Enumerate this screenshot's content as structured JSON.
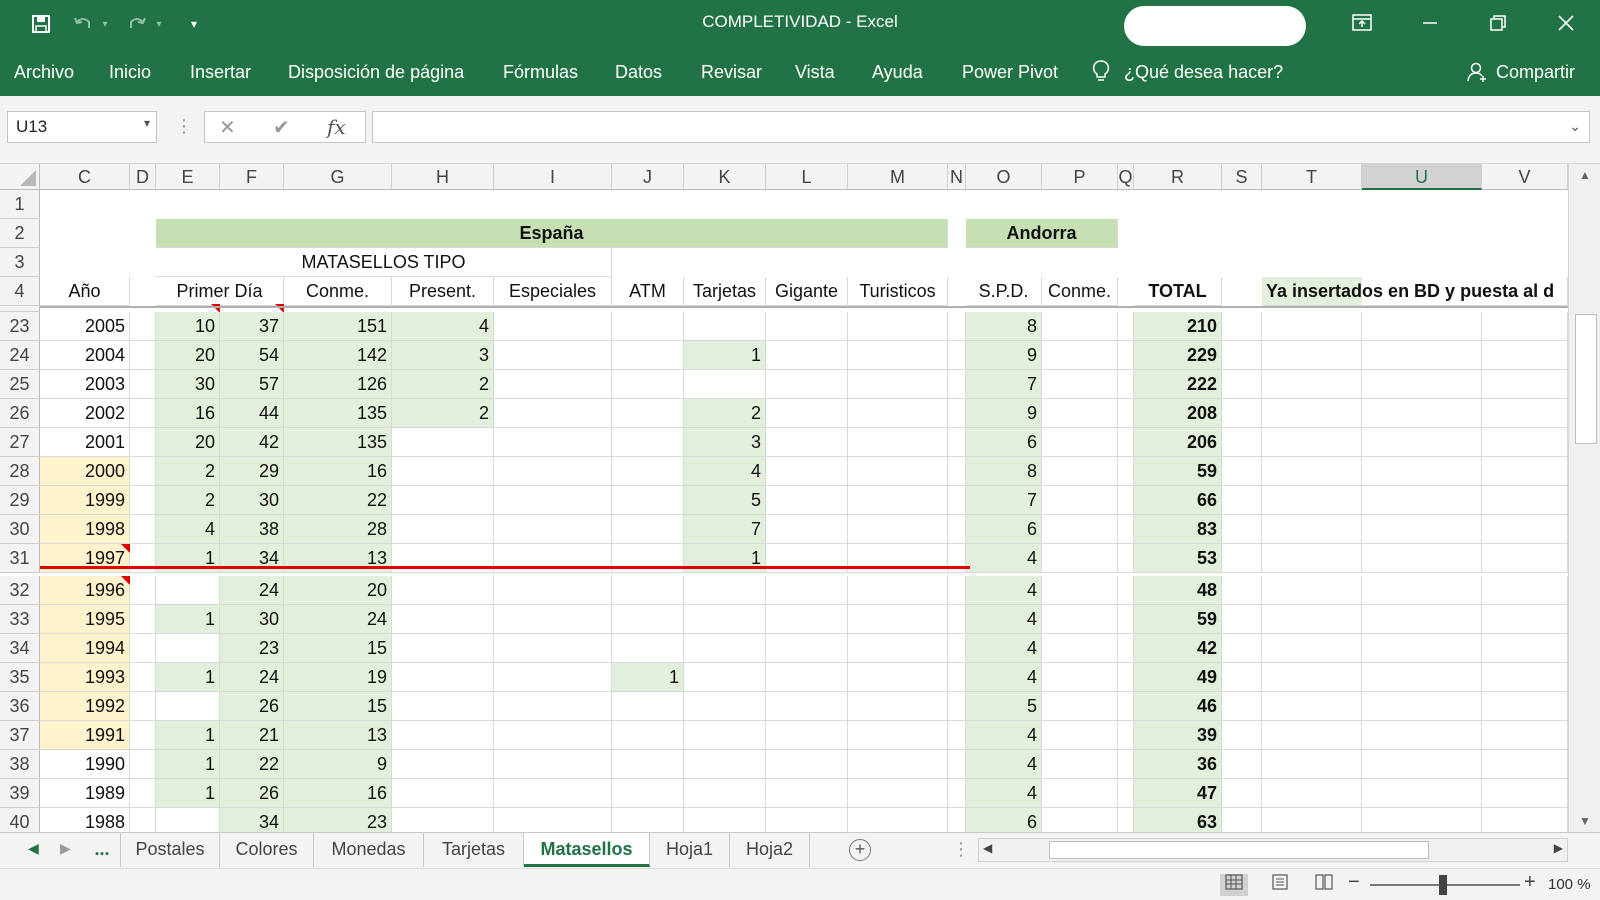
{
  "window": {
    "title": "COMPLETIVIDAD  -  Excel",
    "quick_access": [
      "save-icon",
      "undo-icon",
      "redo-icon",
      "customize-qat-icon"
    ]
  },
  "ribbon": {
    "tabs": [
      "Archivo",
      "Inicio",
      "Insertar",
      "Disposición de página",
      "Fórmulas",
      "Datos",
      "Revisar",
      "Vista",
      "Ayuda",
      "Power Pivot"
    ],
    "tell_me": "¿Qué desea hacer?",
    "share": "Compartir"
  },
  "formula_bar": {
    "name_box": "U13",
    "fx": "fx",
    "formula": ""
  },
  "columns": [
    "C",
    "D",
    "E",
    "F",
    "G",
    "H",
    "I",
    "J",
    "K",
    "L",
    "M",
    "N",
    "O",
    "P",
    "Q",
    "R",
    "S",
    "T",
    "U",
    "V"
  ],
  "selected_column": "U",
  "header_rows": {
    "r1": "1",
    "r2": "2",
    "r3": "3",
    "r4": "4",
    "espana": "España",
    "andorra": "Andorra",
    "matasellos_tipo": "MATASELLOS TIPO",
    "anio": "Año",
    "primer_dia": "Primer Día",
    "conme": "Conme.",
    "present": "Present.",
    "especiales": "Especiales",
    "atm": "ATM",
    "tarjetas": "Tarjetas",
    "gigante": "Gigante",
    "turisticos": "Turisticos",
    "spd": "S.P.D.",
    "conme2": "Conme.",
    "total": "TOTAL",
    "ya_insertados": "Ya insertados en BD y puesta al d"
  },
  "rows": [
    {
      "row": "23",
      "C": "2005",
      "E": "10",
      "F": "37",
      "G": "151",
      "H": "4",
      "J": "",
      "K": "",
      "O": "8",
      "R": "210"
    },
    {
      "row": "24",
      "C": "2004",
      "E": "20",
      "F": "54",
      "G": "142",
      "H": "3",
      "J": "",
      "K": "1",
      "O": "9",
      "R": "229"
    },
    {
      "row": "25",
      "C": "2003",
      "E": "30",
      "F": "57",
      "G": "126",
      "H": "2",
      "J": "",
      "K": "",
      "O": "7",
      "R": "222"
    },
    {
      "row": "26",
      "C": "2002",
      "E": "16",
      "F": "44",
      "G": "135",
      "H": "2",
      "J": "",
      "K": "2",
      "O": "9",
      "R": "208"
    },
    {
      "row": "27",
      "C": "2001",
      "E": "20",
      "F": "42",
      "G": "135",
      "H": "",
      "J": "",
      "K": "3",
      "O": "6",
      "R": "206"
    },
    {
      "row": "28",
      "C": "2000",
      "E": "2",
      "F": "29",
      "G": "16",
      "H": "",
      "J": "",
      "K": "4",
      "O": "8",
      "R": "59"
    },
    {
      "row": "29",
      "C": "1999",
      "E": "2",
      "F": "30",
      "G": "22",
      "H": "",
      "J": "",
      "K": "5",
      "O": "7",
      "R": "66"
    },
    {
      "row": "30",
      "C": "1998",
      "E": "4",
      "F": "38",
      "G": "28",
      "H": "",
      "J": "",
      "K": "7",
      "O": "6",
      "R": "83"
    },
    {
      "row": "31",
      "C": "1997",
      "E": "1",
      "F": "34",
      "G": "13",
      "H": "",
      "J": "",
      "K": "1",
      "O": "4",
      "R": "53"
    },
    {
      "row": "32",
      "C": "1996",
      "E": "",
      "F": "24",
      "G": "20",
      "H": "",
      "J": "",
      "K": "",
      "O": "4",
      "R": "48"
    },
    {
      "row": "33",
      "C": "1995",
      "E": "1",
      "F": "30",
      "G": "24",
      "H": "",
      "J": "",
      "K": "",
      "O": "4",
      "R": "59"
    },
    {
      "row": "34",
      "C": "1994",
      "E": "",
      "F": "23",
      "G": "15",
      "H": "",
      "J": "",
      "K": "",
      "O": "4",
      "R": "42"
    },
    {
      "row": "35",
      "C": "1993",
      "E": "1",
      "F": "24",
      "G": "19",
      "H": "",
      "J": "1",
      "K": "",
      "O": "4",
      "R": "49"
    },
    {
      "row": "36",
      "C": "1992",
      "E": "",
      "F": "26",
      "G": "15",
      "H": "",
      "J": "",
      "K": "",
      "O": "5",
      "R": "46"
    },
    {
      "row": "37",
      "C": "1991",
      "E": "1",
      "F": "21",
      "G": "13",
      "H": "",
      "J": "",
      "K": "",
      "O": "4",
      "R": "39"
    },
    {
      "row": "38",
      "C": "1990",
      "E": "1",
      "F": "22",
      "G": "9",
      "H": "",
      "J": "",
      "K": "",
      "O": "4",
      "R": "36"
    },
    {
      "row": "39",
      "C": "1989",
      "E": "1",
      "F": "26",
      "G": "16",
      "H": "",
      "J": "",
      "K": "",
      "O": "4",
      "R": "47"
    },
    {
      "row": "40",
      "C": "1988",
      "E": "",
      "F": "34",
      "G": "23",
      "H": "",
      "J": "",
      "K": "",
      "O": "6",
      "R": "63"
    }
  ],
  "sheet_tabs": {
    "more": "...",
    "tabs": [
      "Postales",
      "Colores",
      "Monedas",
      "Tarjetas",
      "Matasellos",
      "Hoja1",
      "Hoja2"
    ],
    "active": "Matasellos"
  },
  "status_bar": {
    "zoom": "100 %"
  },
  "colors": {
    "excel_green": "#217346",
    "light_green_fill": "#e2efda",
    "header_green_fill": "#c6e0b4",
    "orange_fill": "#fff2cc",
    "red_line": "#e00000"
  }
}
